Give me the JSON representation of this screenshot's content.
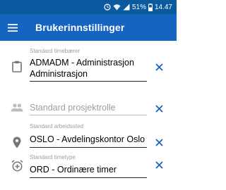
{
  "status_bar": {
    "battery": "51%",
    "time": "14.47",
    "icons": [
      "sync-icon",
      "wifi-icon",
      "signal-icon",
      "battery-icon"
    ]
  },
  "app_bar": {
    "title": "Brukerinnstillinger",
    "menu_icon": "hamburger-menu-icon"
  },
  "colors": {
    "primary": "#1565c0",
    "status_bar": "#0b5aa0",
    "accent_clear": "#1565c0"
  },
  "settings": [
    {
      "label": "Standard timebærer",
      "value": "ADMADM - Administrasjon Administrasjon",
      "placeholder": "",
      "icon": "clipboard-icon"
    },
    {
      "label": "",
      "value": "",
      "placeholder": "Standard prosjektrolle",
      "icon": "people-icon"
    },
    {
      "label": "Standard arbeidssted",
      "value": "OSLO - Avdelingskontor Oslo",
      "placeholder": "",
      "icon": "location-pin-icon"
    },
    {
      "label": "Standard timetype",
      "value": "ORD - Ordinære timer",
      "placeholder": "",
      "icon": "alarm-add-icon"
    }
  ]
}
